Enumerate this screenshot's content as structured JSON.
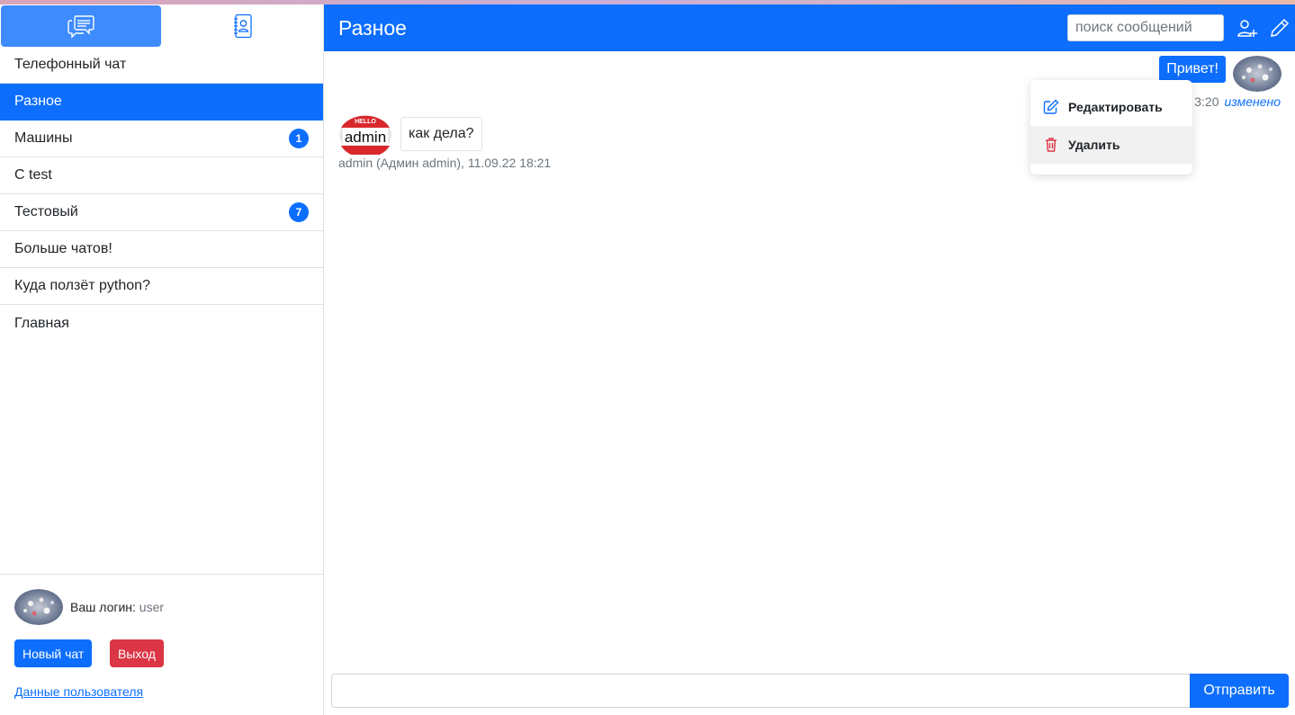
{
  "sidebar": {
    "tabs": [
      {
        "icon": "chat-dots-icon",
        "active": true
      },
      {
        "icon": "contacts-book-icon",
        "active": false
      }
    ],
    "chats": [
      {
        "name": "Телефонный чат",
        "badge": ""
      },
      {
        "name": "Разное",
        "badge": "",
        "active": true
      },
      {
        "name": "Машины",
        "badge": "1"
      },
      {
        "name": "C test",
        "badge": ""
      },
      {
        "name": "Тестовый",
        "badge": "7"
      },
      {
        "name": "Больше чатов!",
        "badge": ""
      },
      {
        "name": "Куда ползёт python?",
        "badge": ""
      },
      {
        "name": "Главная",
        "badge": ""
      }
    ],
    "footer": {
      "login_label": "Ваш логин:",
      "login_value": "user",
      "new_chat_label": "Новый чат",
      "exit_label": "Выход",
      "user_data_link": "Данные пользователя"
    }
  },
  "header": {
    "title": "Разное",
    "search_placeholder": "поиск сообщений",
    "add_user_icon": "person-plus-icon",
    "edit_icon": "pencil-icon"
  },
  "messages": {
    "own": {
      "text": "Привет!",
      "time_partial": "3:20",
      "edited_label": "изменено"
    },
    "other": {
      "avatar_text_top": "HELLO",
      "avatar_text": "admin",
      "text": "как дела?",
      "meta": "admin (Админ admin), 11.09.22 18:21"
    }
  },
  "context_menu": {
    "items": [
      {
        "label": "Редактировать",
        "icon": "edit-square-icon"
      },
      {
        "label": "Удалить",
        "icon": "trash-icon"
      }
    ]
  },
  "composer": {
    "value": "",
    "send_label": "Отправить"
  },
  "colors": {
    "primary": "#0d6efd",
    "danger": "#dc3545",
    "tab_active": "#3d8bfd"
  }
}
